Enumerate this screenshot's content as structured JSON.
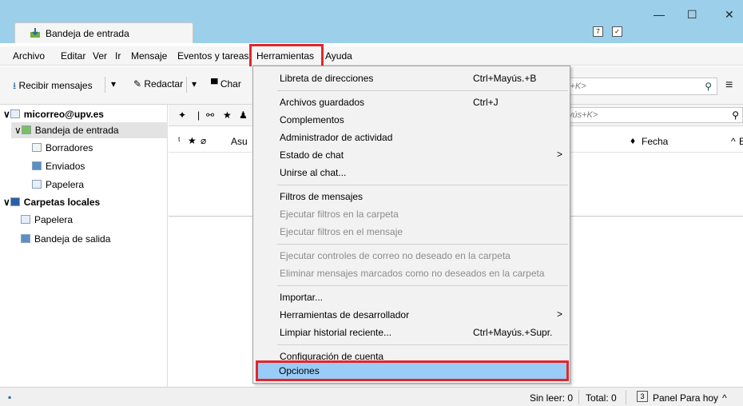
{
  "window": {
    "tab_title": "Bandeja de entrada",
    "controls": {
      "minimize": "—",
      "maximize": "☐",
      "close": "✕"
    },
    "brand_color": "#9ccfe9"
  },
  "menubar": [
    {
      "label": "Archivo"
    },
    {
      "label": "Editar"
    },
    {
      "label": "Ver"
    },
    {
      "label": "Ir"
    },
    {
      "label": "Mensaje"
    },
    {
      "label": "Eventos y tareas"
    },
    {
      "label": "Herramientas"
    },
    {
      "label": "Ayuda"
    }
  ],
  "toolbar": {
    "get_mail": "Recibir mensajes",
    "compose": "Redactar",
    "chat": "Char",
    "search_placeholder": "l+K>",
    "menu_icon": "≡"
  },
  "folders": {
    "account": "micorreo@upv.es",
    "inbox": "Bandeja de entrada",
    "drafts": "Borradores",
    "sent": "Enviados",
    "trash": "Papelera",
    "local_folders": "Carpetas locales",
    "local_trash": "Papelera",
    "outbox": "Bandeja de salida"
  },
  "threadpane": {
    "filter_placeholder": "yús+K>",
    "col_subject": "Asu",
    "col_date": "Fecha",
    "col_extra": "E"
  },
  "dropdown": {
    "items": [
      {
        "label": "Libreta de direcciones",
        "shortcut": "Ctrl+Mayús.+B"
      },
      {
        "label": "Archivos guardados",
        "shortcut": "Ctrl+J"
      },
      {
        "label": "Complementos",
        "shortcut": ""
      },
      {
        "label": "Administrador de actividad",
        "shortcut": ""
      },
      {
        "label": "Estado de chat",
        "shortcut": "",
        "submenu": ">"
      },
      {
        "label": "Unirse al chat...",
        "shortcut": ""
      },
      {
        "label": "Filtros de mensajes",
        "shortcut": ""
      },
      {
        "label": "Ejecutar filtros en la carpeta",
        "shortcut": "",
        "disabled": true
      },
      {
        "label": "Ejecutar filtros en el mensaje",
        "shortcut": "",
        "disabled": true
      },
      {
        "label": "Ejecutar controles de correo no deseado en la carpeta",
        "shortcut": "",
        "disabled": true
      },
      {
        "label": "Eliminar mensajes marcados como no deseados en la carpeta",
        "shortcut": "",
        "disabled": true
      },
      {
        "label": "Importar...",
        "shortcut": ""
      },
      {
        "label": "Herramientas de desarrollador",
        "shortcut": "",
        "submenu": ">"
      },
      {
        "label": "Limpiar historial reciente...",
        "shortcut": "Ctrl+Mayús.+Supr."
      },
      {
        "label": "Configuración de cuenta",
        "shortcut": ""
      },
      {
        "label": "Opciones",
        "shortcut": ""
      }
    ]
  },
  "statusbar": {
    "unread": "Sin leer: 0",
    "total": "Total: 0",
    "today_pane": "Panel Para hoy",
    "today_date": "3"
  },
  "highlight_color": "#e2262b"
}
